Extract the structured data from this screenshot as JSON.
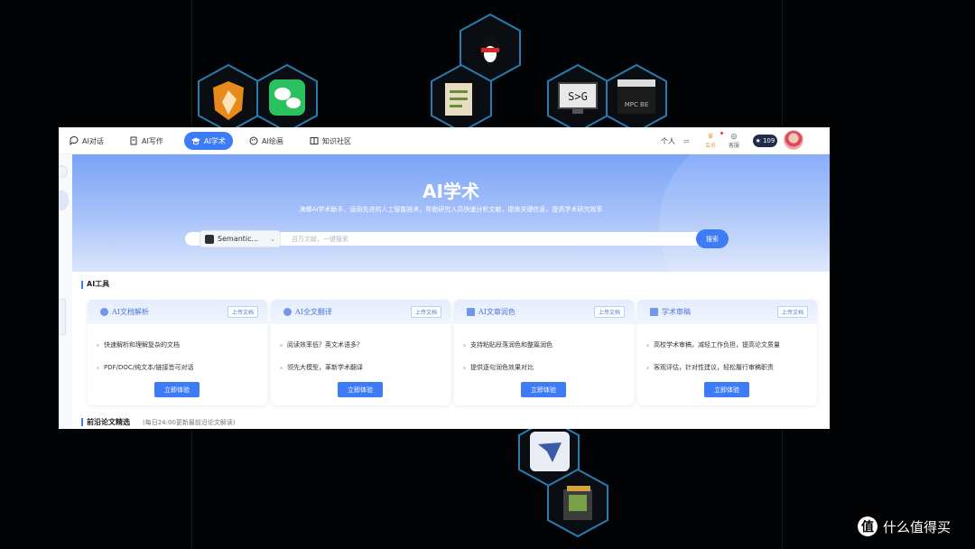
{
  "nav": {
    "items": [
      {
        "label": "AI对话",
        "icon": "chat-bubble-icon"
      },
      {
        "label": "AI写作",
        "icon": "document-icon"
      },
      {
        "label": "AI学术",
        "icon": "graduation-cap-icon"
      },
      {
        "label": "AI绘画",
        "icon": "palette-icon"
      },
      {
        "label": "知识社区",
        "icon": "book-icon"
      }
    ],
    "personal": "个人",
    "switch_icon": "⇌",
    "member_label": "会员",
    "service_label": "客服",
    "points": "109",
    "colors": {
      "active": "#3d7bf7"
    }
  },
  "hero": {
    "title": "AI学术",
    "subtitle": "海螺AI学术助手，运用先进的人工智能技术，帮助研究人员快速分析文献，提炼关键信息，提高学术研究效率",
    "search": {
      "database": "Semantic...",
      "placeholder": "百万文献，一键搜索",
      "button": "搜索"
    }
  },
  "tools": {
    "title": "AI工具",
    "cards": [
      {
        "title": "AI文档解析",
        "upload": "上传文档",
        "features": [
          "快速解析和理解复杂的文档",
          "PDF/DOC/纯文本/链接皆可对话"
        ],
        "button": "立即体验"
      },
      {
        "title": "AI全文翻译",
        "upload": "上传文档",
        "features": [
          "阅读效率低？英文术语多？",
          "领先大模型，革新学术翻译"
        ],
        "button": "立即体验"
      },
      {
        "title": "AI文章润色",
        "upload": "上传文档",
        "features": [
          "支持粘贴段落润色和整篇润色",
          "提供逐句润色效果对比"
        ],
        "button": "立即体验"
      },
      {
        "title": "学术审稿",
        "upload": "上传文档",
        "features": [
          "高校学术审稿，减轻工作负担，提高论文质量",
          "客观评估，针对性建议，轻松履行审稿职责"
        ],
        "button": "立即体验"
      }
    ]
  },
  "papers": {
    "title": "前沿论文精选",
    "note": "(每日24:00更新最前沿论文解读)"
  },
  "watermark": {
    "logo": "值",
    "text": "什么值得买"
  }
}
